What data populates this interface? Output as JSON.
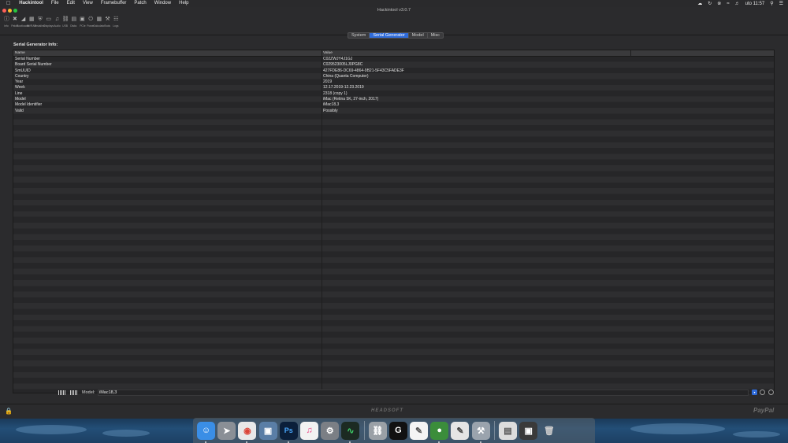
{
  "menubar": {
    "items": [
      "Hackintool",
      "File",
      "Edit",
      "View",
      "Framebuffer",
      "Patch",
      "Window",
      "Help"
    ],
    "clock": "uto 11:57"
  },
  "window": {
    "title": "Hackintool v3.0.7"
  },
  "toolbar": {
    "items": [
      {
        "label": "Info",
        "icon": "info-icon"
      },
      {
        "label": "Patch",
        "icon": "patch-icon"
      },
      {
        "label": "Bootloader",
        "icon": "boot-icon"
      },
      {
        "label": "NVRAM",
        "icon": "chip-icon"
      },
      {
        "label": "Installed",
        "icon": "shield-icon"
      },
      {
        "label": "Displays",
        "icon": "display-icon"
      },
      {
        "label": "Audio",
        "icon": "speaker-icon"
      },
      {
        "label": "USB",
        "icon": "usb-icon"
      },
      {
        "label": "Disks",
        "icon": "disk-icon"
      },
      {
        "label": "PCIe",
        "icon": "pci-icon"
      },
      {
        "label": "Power",
        "icon": "power-icon"
      },
      {
        "label": "Calculator",
        "icon": "calculator-icon"
      },
      {
        "label": "Tools",
        "icon": "tools-icon"
      },
      {
        "label": "Logs",
        "icon": "logs-icon"
      }
    ]
  },
  "tabs": [
    "System",
    "Serial Generator",
    "Model",
    "Misc"
  ],
  "active_tab": "Serial Generator",
  "section": {
    "title": "Serial Generator Info:"
  },
  "table": {
    "headers": [
      "Name",
      "Value"
    ],
    "rows": [
      [
        "Serial Number",
        "C02ZWJY4J1GJ"
      ],
      [
        "Board Serial Number",
        "C029523005LJ0PG8C"
      ],
      [
        "SmUUID",
        "427FDE86-DC69-4864-9B21-5F43C5FADE3F"
      ],
      [
        "Country",
        "China (Quanta Computer)"
      ],
      [
        "Year",
        "2019"
      ],
      [
        "Week",
        "12.17.2019-12.23.2019"
      ],
      [
        "Line",
        "2318 (copy 1)"
      ],
      [
        "Model",
        "iMac (Retina 5K, 27-inch, 2017)"
      ],
      [
        "Model Identifier",
        "iMac18,3"
      ],
      [
        "Valid",
        "Possibly"
      ]
    ]
  },
  "bottom": {
    "model_label": "Model:",
    "model_value": "iMac18,3"
  },
  "footer": {
    "brand": "HEADSOFT",
    "donate": "PayPal"
  },
  "accent_color": "#2f6bd9"
}
